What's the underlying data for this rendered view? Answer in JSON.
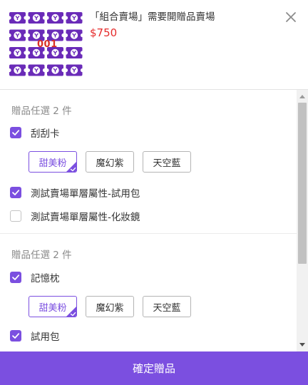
{
  "product": {
    "title": "「組合賣場」需要開贈品賣場",
    "price": "$750",
    "thumbnail_code": "001",
    "thumbnail_icon": "ticket-grid-icon"
  },
  "groups": [
    {
      "title": "贈品任選 2 件",
      "options": [
        {
          "label": "刮刮卡",
          "checked": true,
          "chips": [
            "甜美粉",
            "魔幻紫",
            "天空藍"
          ],
          "selected_chip": "甜美粉"
        },
        {
          "label": "測試賣場單層屬性-試用包",
          "checked": true
        },
        {
          "label": "測試賣場單層屬性-化妝鏡",
          "checked": false
        }
      ]
    },
    {
      "title": "贈品任選 2 件",
      "options": [
        {
          "label": "記憶枕",
          "checked": true,
          "chips": [
            "甜美粉",
            "魔幻紫",
            "天空藍"
          ],
          "selected_chip": "甜美粉"
        },
        {
          "label": "試用包",
          "checked": true
        }
      ]
    }
  ],
  "footer": {
    "confirm_label": "確定贈品"
  },
  "colors": {
    "accent": "#7b4fe0",
    "price": "#e52b2b",
    "muted": "#8a8a8a"
  },
  "icons": {
    "close": "close-icon",
    "check": "check-icon",
    "chip_corner": "check-corner-icon"
  }
}
